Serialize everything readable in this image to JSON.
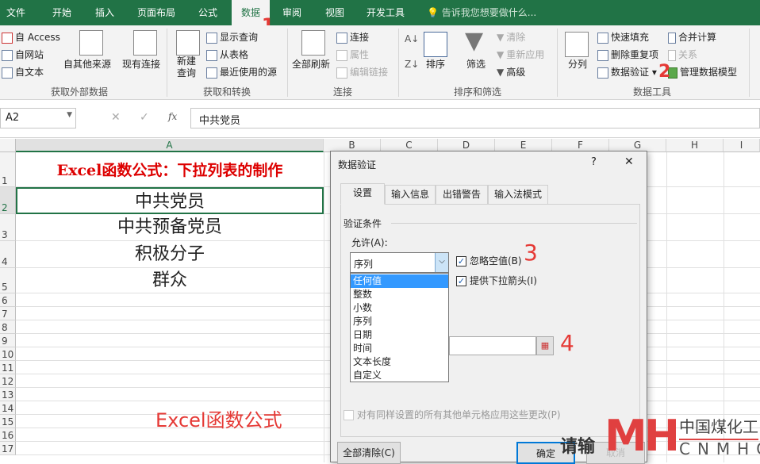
{
  "tabs": [
    "文件",
    "开始",
    "插入",
    "页面布局",
    "公式",
    "数据",
    "审阅",
    "视图",
    "开发工具"
  ],
  "tell_me": "告诉我您想要做什么...",
  "ribbon": {
    "get_external": {
      "items": [
        "自 Access",
        "自网站",
        "自文本",
        "自其他来源",
        "现有连接"
      ],
      "label": "获取外部数据"
    },
    "get_transform": {
      "new_query": "新建查询",
      "items": [
        "显示查询",
        "从表格",
        "最近使用的源"
      ],
      "label": "获取和转换"
    },
    "connections": {
      "refresh_all": "全部刷新",
      "items": [
        "连接",
        "属性",
        "编辑链接"
      ],
      "label": "连接"
    },
    "sort_filter": {
      "sort": "排序",
      "filter": "筛选",
      "items": [
        "清除",
        "重新应用",
        "高级"
      ],
      "label": "排序和筛选"
    },
    "data_tools": {
      "text_to_columns": "分列",
      "items": [
        "快速填充",
        "删除重复项",
        "数据验证",
        "合并计算",
        "关系",
        "管理数据模型"
      ],
      "label": "数据工具"
    }
  },
  "annotations": [
    "1",
    "2",
    "3",
    "4"
  ],
  "name_box": "A2",
  "formula": "中共党员",
  "columns": [
    "A",
    "B",
    "C",
    "D",
    "E",
    "F",
    "G",
    "H",
    "I"
  ],
  "rows": [
    "1",
    "2",
    "3",
    "4",
    "5",
    "6",
    "7",
    "8",
    "9",
    "10",
    "11",
    "12",
    "13",
    "14",
    "15",
    "16",
    "17"
  ],
  "cells": {
    "title": "Excel函数公式：下拉列表的制作",
    "values": [
      "中共党员",
      "中共预备党员",
      "积极分子",
      "群众"
    ],
    "watermark": "Excel函数公式"
  },
  "dialog": {
    "title": "数据验证",
    "help": "?",
    "close": "✕",
    "tabs": [
      "设置",
      "输入信息",
      "出错警告",
      "输入法模式"
    ],
    "section": "验证条件",
    "allow_label": "允许(A):",
    "allow_value": "序列",
    "options": [
      "任何值",
      "整数",
      "小数",
      "序列",
      "日期",
      "时间",
      "文本长度",
      "自定义"
    ],
    "ignore_blank": "忽略空值(B)",
    "dropdown": "提供下拉箭头(I)",
    "apply_all": "对有同样设置的所有其他单元格应用这些更改(P)",
    "clear_all": "全部清除(C)",
    "ok": "确定",
    "cancel": "取消"
  },
  "logo": {
    "mark": "MH",
    "cn": "中国煤化工",
    "en": "CNMHG",
    "overlay": "请输"
  },
  "colors": {
    "excel_green": "#217346",
    "annotation_red": "#e53935",
    "select_blue": "#3399ff"
  }
}
